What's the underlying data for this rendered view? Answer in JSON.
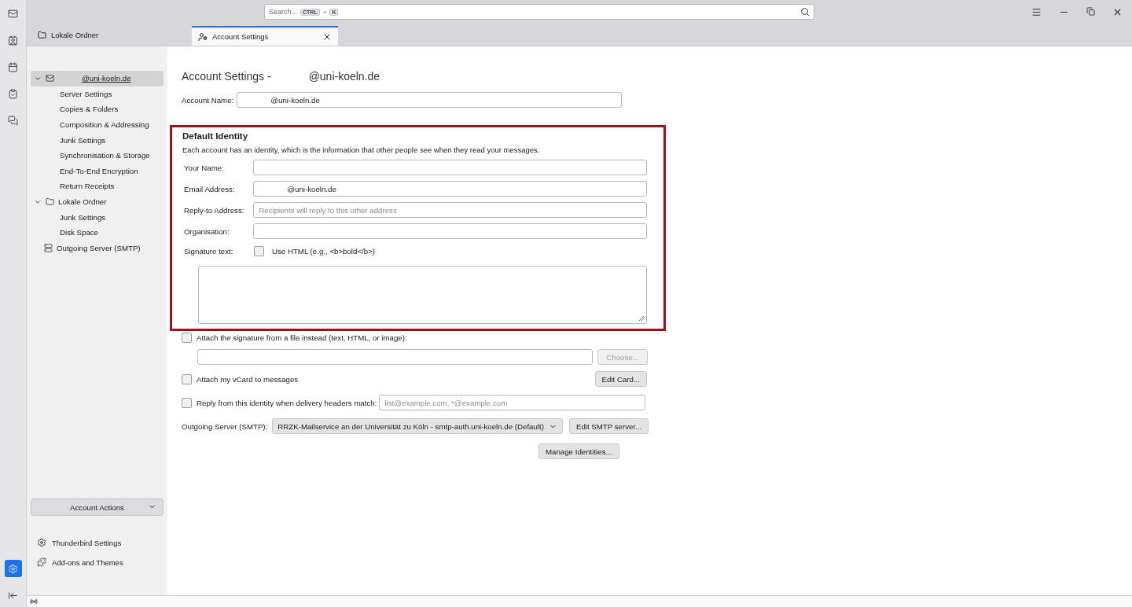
{
  "search": {
    "placeholder": "Search...",
    "shortcut": [
      "CTRL",
      "+",
      "K"
    ]
  },
  "spaces": {
    "settings_selected": true
  },
  "tabs": [
    {
      "label": "Lokale Ordner",
      "kind": "folder",
      "selected": false,
      "closable": false
    },
    {
      "label": "Account Settings",
      "kind": "settings",
      "selected": true,
      "closable": true
    }
  ],
  "sidebar": {
    "items": [
      {
        "label": "@uni-koeln.de",
        "kind": "account",
        "selected": true,
        "expanded": true,
        "children": [
          {
            "label": "Server Settings",
            "selected": false
          },
          {
            "label": "Copies & Folders",
            "selected": false
          },
          {
            "label": "Composition & Addressing",
            "selected": false
          },
          {
            "label": "Junk Settings",
            "selected": false
          },
          {
            "label": "Synchronisation & Storage",
            "selected": false
          },
          {
            "label": "End-To-End Encryption",
            "selected": false
          },
          {
            "label": "Return Receipts",
            "selected": false
          }
        ]
      },
      {
        "label": "Lokale Ordner",
        "kind": "folder",
        "selected": false,
        "expanded": true,
        "children": [
          {
            "label": "Junk Settings",
            "selected": false
          },
          {
            "label": "Disk Space",
            "selected": false
          }
        ]
      },
      {
        "label": "Outgoing Server (SMTP)",
        "kind": "smtp",
        "selected": false
      }
    ],
    "account_actions": "Account Actions",
    "footer_links": [
      {
        "label": "Thunderbird Settings",
        "kind": "settings"
      },
      {
        "label": "Add-ons and Themes",
        "kind": "addons"
      }
    ]
  },
  "content": {
    "title": "Account Settings -",
    "title_address": "@uni-koeln.de",
    "account_name": {
      "label": "Account Name:",
      "value": "@uni-koeln.de"
    },
    "identity": {
      "heading": "Default Identity",
      "description": "Each account has an identity, which is the information that other people see when they read your messages.",
      "fields": [
        {
          "label": "Your Name:"
        },
        {
          "label": "Email Address:",
          "value": "@uni-koeln.de"
        },
        {
          "label": "Reply-to Address:",
          "placeholder": "Recipients will reply to this other address"
        },
        {
          "label": "Organisation:"
        }
      ],
      "signature": {
        "label": "Signature text:",
        "use_html": {
          "label": "Use HTML (e.g., <b>bold</b>)",
          "checked": false
        }
      }
    },
    "attach_file": {
      "label": "Attach the signature from a file instead (text, HTML, or image):",
      "checked": false,
      "button": "Choose...",
      "button_disabled": true
    },
    "vcard": {
      "label": "Attach my vCard to messages",
      "checked": false,
      "button": "Edit Card..."
    },
    "reply_from": {
      "label": "Reply from this identity when delivery headers match:",
      "checked": false,
      "placeholder": "list@example.com, *@example.com"
    },
    "outgoing": {
      "label": "Outgoing Server (SMTP):",
      "value": "RRZK-Mailservice an der Universität zu Köln - smtp-auth.uni-koeln.de (Default)",
      "button": "Edit SMTP server..."
    },
    "manage_button": "Manage Identities..."
  }
}
